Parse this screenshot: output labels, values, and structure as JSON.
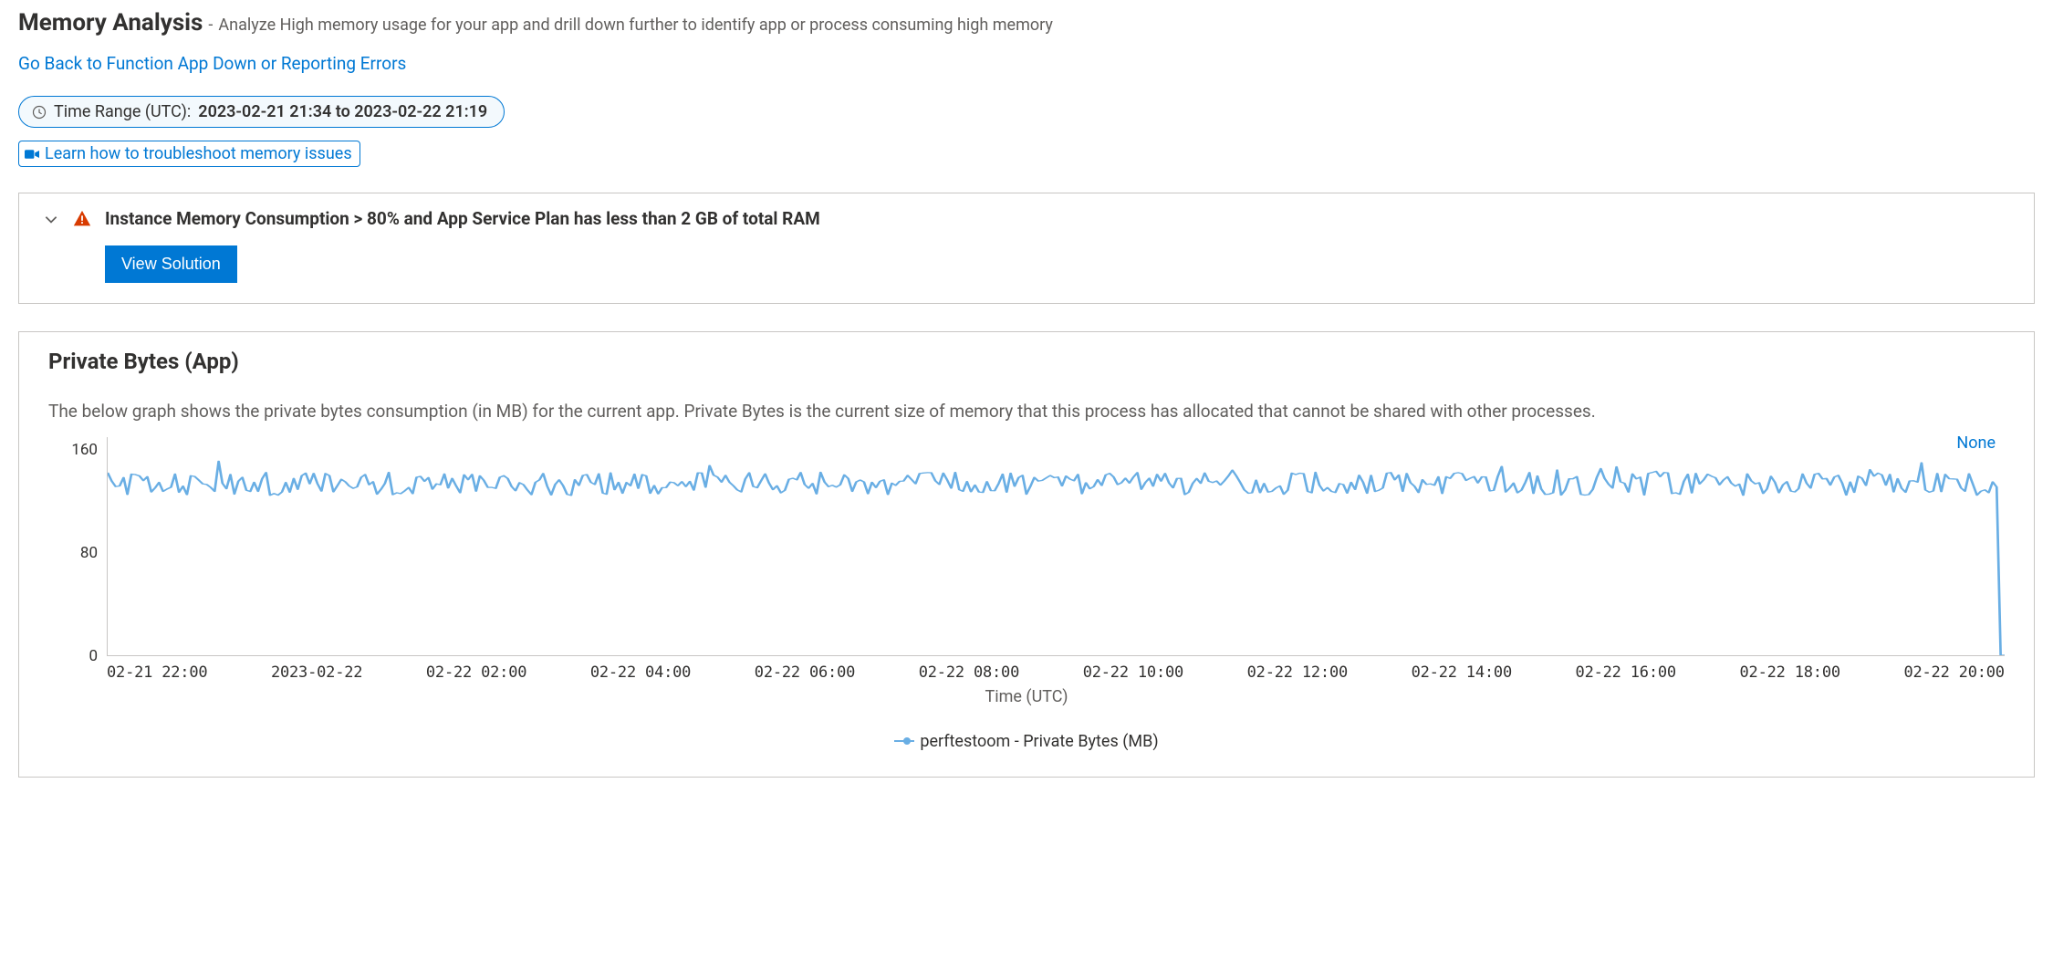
{
  "header": {
    "title": "Memory Analysis",
    "separator": " - ",
    "subtitle": "Analyze High memory usage for your app and drill down further to identify app or process consuming high memory"
  },
  "back_link": "Go Back to Function App Down or Reporting Errors",
  "time_range": {
    "prefix": "Time Range (UTC): ",
    "value": "2023-02-21 21:34 to 2023-02-22 21:19"
  },
  "learn_link": "Learn how to troubleshoot memory issues",
  "insight": {
    "title": "Instance Memory Consumption > 80% and App Service Plan has less than 2 GB of total RAM",
    "button": "View Solution"
  },
  "chart_card": {
    "title": "Private Bytes (App)",
    "description": "The below graph shows the private bytes consumption (in MB) for the current app. Private Bytes is the current size of memory that this process has allocated that cannot be shared with other processes.",
    "none_label": "None"
  },
  "chart_data": {
    "type": "line",
    "title": "Private Bytes (App)",
    "xlabel": "Time (UTC)",
    "ylabel": "",
    "ylim": [
      0,
      170
    ],
    "y_ticks": [
      0,
      80,
      160
    ],
    "x_tick_labels": [
      "02-21 22:00",
      "2023-02-22",
      "02-22 02:00",
      "02-22 04:00",
      "02-22 06:00",
      "02-22 08:00",
      "02-22 10:00",
      "02-22 12:00",
      "02-22 14:00",
      "02-22 16:00",
      "02-22 18:00",
      "02-22 20:00"
    ],
    "series": [
      {
        "name": "perftestoom - Private Bytes (MB)",
        "color": "#69aee4",
        "approx_value": 130,
        "note": "Series fluctuates between roughly 120 and 145 MB across the full time window, then drops to 0 at the very end (~2023-02-22 21:19)."
      }
    ]
  },
  "colors": {
    "link": "#0078d4",
    "primary_button": "#0078d4",
    "warning": "#d83b01",
    "series": "#69aee4",
    "border": "#c8c6c4"
  }
}
